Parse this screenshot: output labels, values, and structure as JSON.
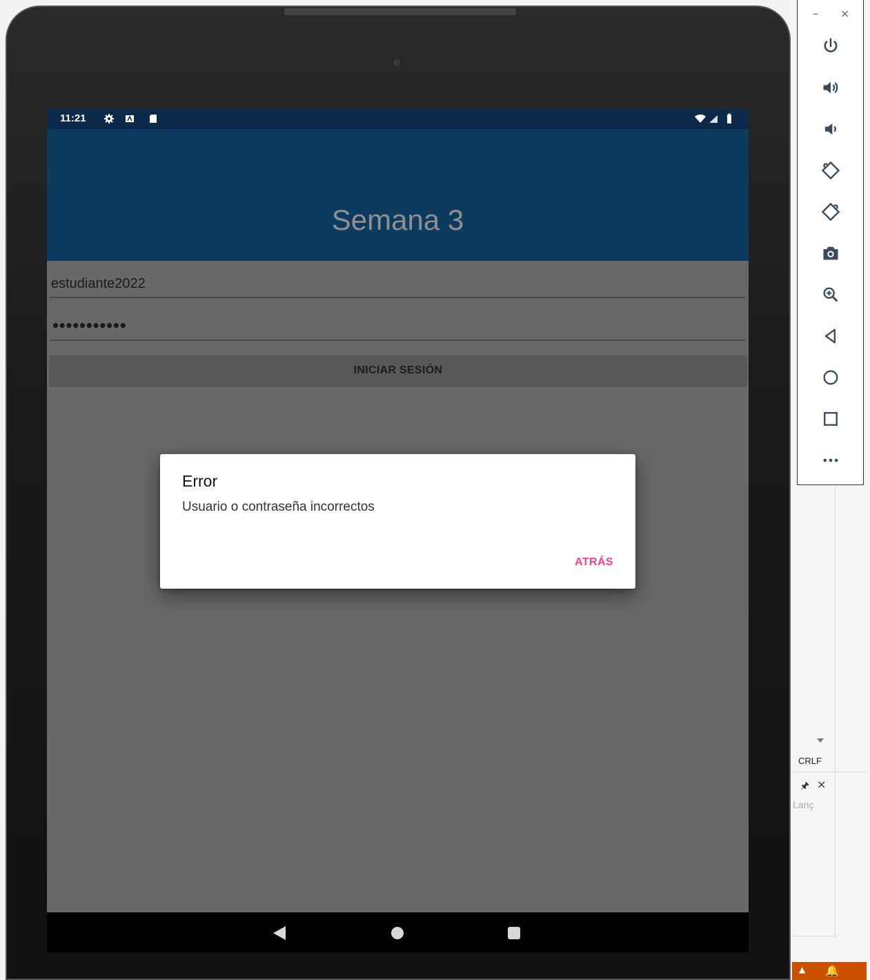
{
  "status_bar": {
    "time": "11:21",
    "icons": [
      "gear-icon",
      "a11y-icon",
      "sd-card-icon",
      "wifi-icon",
      "signal-icon",
      "battery-icon"
    ]
  },
  "app": {
    "title": "Semana 3"
  },
  "form": {
    "username_value": "estudiante2022",
    "password_dots": "•••••••••••",
    "login_label": "INICIAR SESIÓN"
  },
  "dialog": {
    "title": "Error",
    "message": "Usuario o contraseña incorrectos",
    "button_label": "ATRÁS",
    "accent_color": "#ff4081"
  },
  "emulator_toolbar": {
    "minimize": "–",
    "close": "×",
    "buttons": [
      "power-icon",
      "volume-up-icon",
      "volume-down-icon",
      "rotate-left-icon",
      "rotate-right-icon",
      "camera-icon",
      "zoom-icon",
      "back-icon",
      "home-icon",
      "overview-icon",
      "more-icon"
    ]
  },
  "ide": {
    "line_ending": "CRLF",
    "pin_glyph": "🖈",
    "close_glyph": "×",
    "lang_text": "Lanç",
    "status_caret": "▲",
    "status_bell": "🔔"
  },
  "colors": {
    "status_bar": "#0b2a4a",
    "app_bar": "#0d3a5f",
    "screen_dim": "#686868",
    "ide_status": "#ca5100"
  }
}
